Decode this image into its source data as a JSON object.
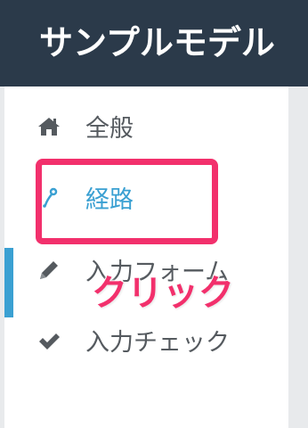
{
  "header": {
    "title": "サンプルモデル"
  },
  "sidebar": {
    "items": [
      {
        "label": "全般",
        "icon": "home-icon",
        "active": false
      },
      {
        "label": "経路",
        "icon": "route-icon",
        "active": true
      },
      {
        "label": "入力フォーム",
        "icon": "pencil-icon",
        "active": false
      },
      {
        "label": "入力チェック",
        "icon": "check-icon",
        "active": false
      }
    ]
  },
  "annotation": {
    "text": "クリック"
  },
  "colors": {
    "header_bg": "#2b3a4a",
    "accent": "#3aa0d2",
    "highlight": "#f2306c",
    "text": "#555a5f",
    "background": "#e8eaec"
  }
}
